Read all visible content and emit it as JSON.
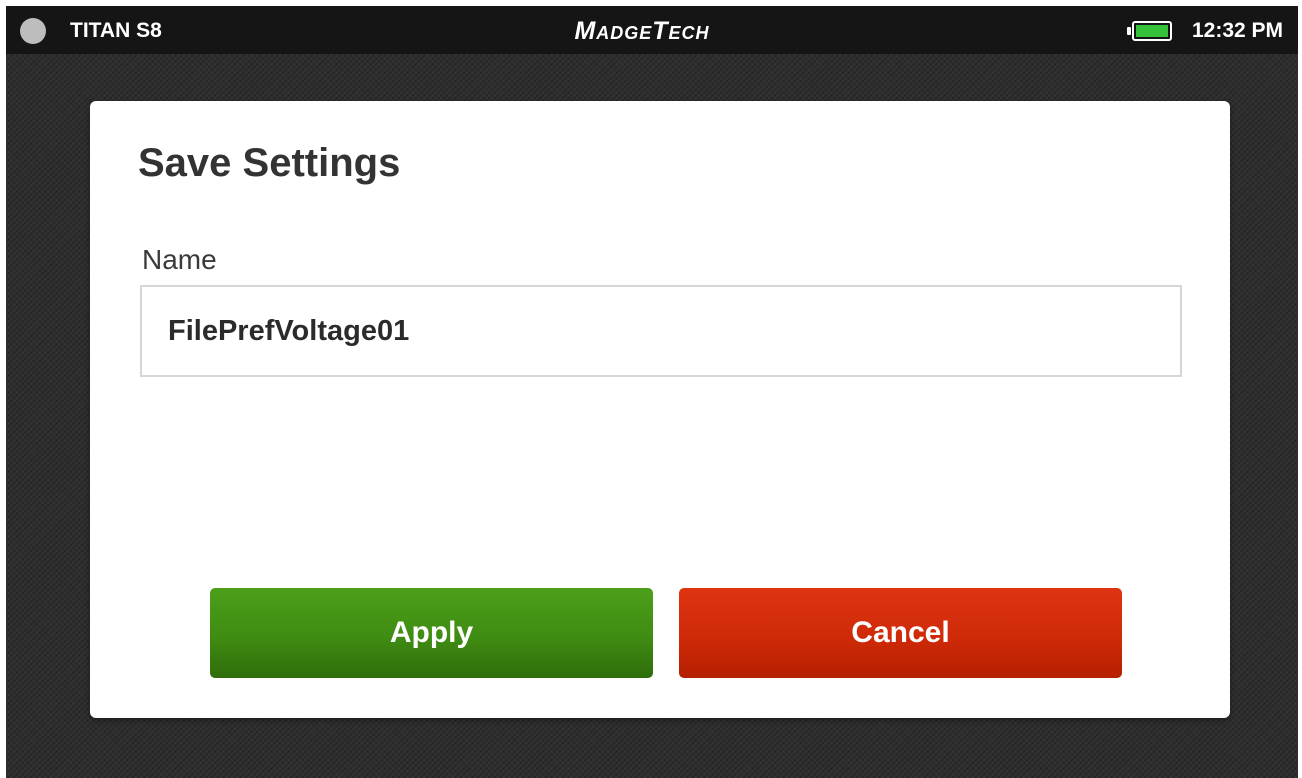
{
  "statusbar": {
    "device_name": "TITAN S8",
    "brand": "MadgeTech",
    "battery_level": 1.0,
    "time": "12:32 PM"
  },
  "dialog": {
    "title": "Save Settings",
    "name_label": "Name",
    "name_value": "FilePrefVoltage01",
    "apply_label": "Apply",
    "cancel_label": "Cancel"
  },
  "colors": {
    "apply": "#3f8c12",
    "cancel": "#cf2a08",
    "battery": "#36c13a",
    "statusbar": "#151515"
  }
}
